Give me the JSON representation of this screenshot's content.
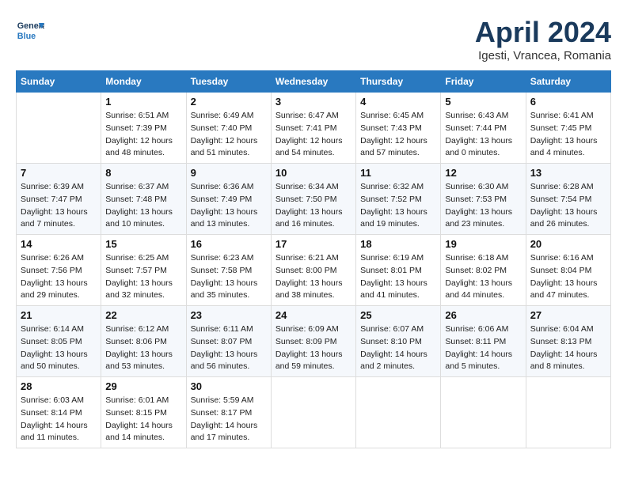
{
  "header": {
    "logo_line1": "General",
    "logo_line2": "Blue",
    "month": "April 2024",
    "location": "Igesti, Vrancea, Romania"
  },
  "days_of_week": [
    "Sunday",
    "Monday",
    "Tuesday",
    "Wednesday",
    "Thursday",
    "Friday",
    "Saturday"
  ],
  "weeks": [
    [
      {
        "day": "",
        "info": ""
      },
      {
        "day": "1",
        "info": "Sunrise: 6:51 AM\nSunset: 7:39 PM\nDaylight: 12 hours\nand 48 minutes."
      },
      {
        "day": "2",
        "info": "Sunrise: 6:49 AM\nSunset: 7:40 PM\nDaylight: 12 hours\nand 51 minutes."
      },
      {
        "day": "3",
        "info": "Sunrise: 6:47 AM\nSunset: 7:41 PM\nDaylight: 12 hours\nand 54 minutes."
      },
      {
        "day": "4",
        "info": "Sunrise: 6:45 AM\nSunset: 7:43 PM\nDaylight: 12 hours\nand 57 minutes."
      },
      {
        "day": "5",
        "info": "Sunrise: 6:43 AM\nSunset: 7:44 PM\nDaylight: 13 hours\nand 0 minutes."
      },
      {
        "day": "6",
        "info": "Sunrise: 6:41 AM\nSunset: 7:45 PM\nDaylight: 13 hours\nand 4 minutes."
      }
    ],
    [
      {
        "day": "7",
        "info": "Sunrise: 6:39 AM\nSunset: 7:47 PM\nDaylight: 13 hours\nand 7 minutes."
      },
      {
        "day": "8",
        "info": "Sunrise: 6:37 AM\nSunset: 7:48 PM\nDaylight: 13 hours\nand 10 minutes."
      },
      {
        "day": "9",
        "info": "Sunrise: 6:36 AM\nSunset: 7:49 PM\nDaylight: 13 hours\nand 13 minutes."
      },
      {
        "day": "10",
        "info": "Sunrise: 6:34 AM\nSunset: 7:50 PM\nDaylight: 13 hours\nand 16 minutes."
      },
      {
        "day": "11",
        "info": "Sunrise: 6:32 AM\nSunset: 7:52 PM\nDaylight: 13 hours\nand 19 minutes."
      },
      {
        "day": "12",
        "info": "Sunrise: 6:30 AM\nSunset: 7:53 PM\nDaylight: 13 hours\nand 23 minutes."
      },
      {
        "day": "13",
        "info": "Sunrise: 6:28 AM\nSunset: 7:54 PM\nDaylight: 13 hours\nand 26 minutes."
      }
    ],
    [
      {
        "day": "14",
        "info": "Sunrise: 6:26 AM\nSunset: 7:56 PM\nDaylight: 13 hours\nand 29 minutes."
      },
      {
        "day": "15",
        "info": "Sunrise: 6:25 AM\nSunset: 7:57 PM\nDaylight: 13 hours\nand 32 minutes."
      },
      {
        "day": "16",
        "info": "Sunrise: 6:23 AM\nSunset: 7:58 PM\nDaylight: 13 hours\nand 35 minutes."
      },
      {
        "day": "17",
        "info": "Sunrise: 6:21 AM\nSunset: 8:00 PM\nDaylight: 13 hours\nand 38 minutes."
      },
      {
        "day": "18",
        "info": "Sunrise: 6:19 AM\nSunset: 8:01 PM\nDaylight: 13 hours\nand 41 minutes."
      },
      {
        "day": "19",
        "info": "Sunrise: 6:18 AM\nSunset: 8:02 PM\nDaylight: 13 hours\nand 44 minutes."
      },
      {
        "day": "20",
        "info": "Sunrise: 6:16 AM\nSunset: 8:04 PM\nDaylight: 13 hours\nand 47 minutes."
      }
    ],
    [
      {
        "day": "21",
        "info": "Sunrise: 6:14 AM\nSunset: 8:05 PM\nDaylight: 13 hours\nand 50 minutes."
      },
      {
        "day": "22",
        "info": "Sunrise: 6:12 AM\nSunset: 8:06 PM\nDaylight: 13 hours\nand 53 minutes."
      },
      {
        "day": "23",
        "info": "Sunrise: 6:11 AM\nSunset: 8:07 PM\nDaylight: 13 hours\nand 56 minutes."
      },
      {
        "day": "24",
        "info": "Sunrise: 6:09 AM\nSunset: 8:09 PM\nDaylight: 13 hours\nand 59 minutes."
      },
      {
        "day": "25",
        "info": "Sunrise: 6:07 AM\nSunset: 8:10 PM\nDaylight: 14 hours\nand 2 minutes."
      },
      {
        "day": "26",
        "info": "Sunrise: 6:06 AM\nSunset: 8:11 PM\nDaylight: 14 hours\nand 5 minutes."
      },
      {
        "day": "27",
        "info": "Sunrise: 6:04 AM\nSunset: 8:13 PM\nDaylight: 14 hours\nand 8 minutes."
      }
    ],
    [
      {
        "day": "28",
        "info": "Sunrise: 6:03 AM\nSunset: 8:14 PM\nDaylight: 14 hours\nand 11 minutes."
      },
      {
        "day": "29",
        "info": "Sunrise: 6:01 AM\nSunset: 8:15 PM\nDaylight: 14 hours\nand 14 minutes."
      },
      {
        "day": "30",
        "info": "Sunrise: 5:59 AM\nSunset: 8:17 PM\nDaylight: 14 hours\nand 17 minutes."
      },
      {
        "day": "",
        "info": ""
      },
      {
        "day": "",
        "info": ""
      },
      {
        "day": "",
        "info": ""
      },
      {
        "day": "",
        "info": ""
      }
    ]
  ]
}
